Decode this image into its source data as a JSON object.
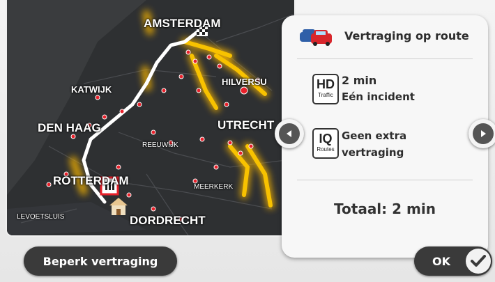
{
  "map": {
    "cities": {
      "amsterdam": "AMSTERDAM",
      "katwijk": "KATWIJK",
      "hilversum": "HILVERSU",
      "den_haag": "DEN HAAG",
      "utrecht": "UTRECHT",
      "reeuwijk": "REEUWIJK",
      "rotterdam": "ROTTERDAM",
      "meerkerk": "MEERKERK",
      "hellevoetsluis": "LEVOETSLUIS",
      "dordrecht": "DORDRECHT"
    }
  },
  "panel": {
    "title": "Vertraging op route",
    "hd_traffic": {
      "badge_main": "HD",
      "badge_sub": "Traffic",
      "line1": "2 min",
      "line2": "Eén incident"
    },
    "iq_routes": {
      "badge_main": "IQ",
      "badge_sub": "Routes",
      "line1": "Geen extra",
      "line2": "vertraging"
    },
    "total": "Totaal:  2 min"
  },
  "buttons": {
    "limit_delay": "Beperk vertraging",
    "ok": "OK"
  },
  "colors": {
    "map_background": "#2e3032",
    "route": "#ffffff",
    "traffic_glow": "#f5b300",
    "incident": "#e8202a",
    "button_dark": "#3a3a3a"
  }
}
